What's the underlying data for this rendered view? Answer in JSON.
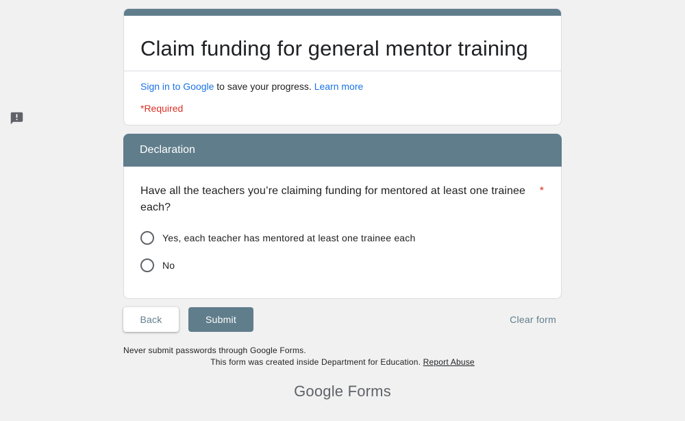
{
  "form": {
    "title": "Claim funding for general mentor training",
    "signin": {
      "link_label": "Sign in to Google",
      "middle_text": " to save your progress. ",
      "learn_more": "Learn more"
    },
    "required_note": "*Required"
  },
  "section": {
    "title": "Declaration"
  },
  "question": {
    "text": "Have all the teachers you’re claiming funding for mentored at least one trainee each?",
    "required_marker": "*",
    "options": [
      {
        "label": "Yes, each teacher has mentored at least one trainee each"
      },
      {
        "label": "No"
      }
    ]
  },
  "buttons": {
    "back": "Back",
    "submit": "Submit",
    "clear": "Clear form"
  },
  "footer": {
    "never_submit": "Never submit passwords through Google Forms.",
    "created_text": "This form was created inside Department for Education.",
    "report_abuse": "Report Abuse",
    "logo_google": "Google",
    "logo_forms": "Forms"
  },
  "colors": {
    "theme": "#607d8b",
    "link": "#1a73e8",
    "required": "#d93025",
    "background": "#f1f1f1"
  },
  "icons": {
    "feedback": "report-feedback-icon"
  }
}
